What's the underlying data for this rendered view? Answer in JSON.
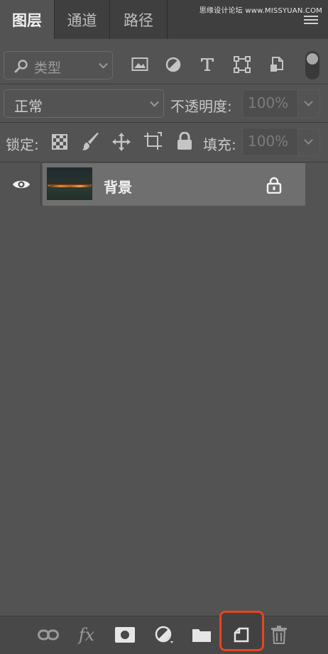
{
  "tabs": [
    {
      "label": "图层",
      "active": true
    },
    {
      "label": "通道",
      "active": false
    },
    {
      "label": "路径",
      "active": false
    }
  ],
  "watermark": "思缘设计论坛 www.MISSYUAN.COM",
  "filter": {
    "label": "类型",
    "icons": [
      "image-filter-icon",
      "adjustment-filter-icon",
      "type-filter-icon",
      "shape-filter-icon",
      "smart-object-filter-icon",
      "filter-toggle"
    ]
  },
  "blend": {
    "mode": "正常",
    "opacity_label": "不透明度:",
    "opacity_value": "100%"
  },
  "lock": {
    "label": "锁定:",
    "fill_label": "填充:",
    "fill_value": "100%"
  },
  "layers": [
    {
      "name": "背景",
      "visible": true,
      "locked": true
    }
  ],
  "bottom_icons": [
    "link-layers-icon",
    "fx-icon",
    "add-mask-icon",
    "adjustment-layer-icon",
    "new-group-icon",
    "new-layer-icon",
    "delete-layer-icon"
  ],
  "bottom_fx_label": "fx",
  "colors": {
    "panel": "#535353",
    "tabbar": "#3f3f3f",
    "selected_layer": "#6f6f6f",
    "highlight": "#e8451f"
  }
}
